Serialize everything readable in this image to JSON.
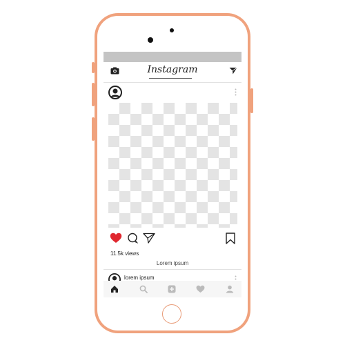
{
  "header": {
    "title": "Instagram",
    "camera_icon": "camera-icon",
    "send_icon": "send-icon"
  },
  "post": {
    "avatar_icon": "user-avatar-icon",
    "more_icon": "more-vertical-icon",
    "actions": [
      "heart-filled-icon",
      "comment-icon",
      "send-icon",
      "bookmark-icon"
    ],
    "views": "11.5k views",
    "caption": "Lorem ipsum"
  },
  "next_post": {
    "username": "lorem ipsum"
  },
  "bottom_nav": [
    "home-icon",
    "search-icon",
    "add-icon",
    "heart-icon",
    "profile-icon"
  ],
  "colors": {
    "phone_frame": "#f0a27d",
    "like": "#e0272f",
    "status_bar": "#c4c4c4"
  }
}
